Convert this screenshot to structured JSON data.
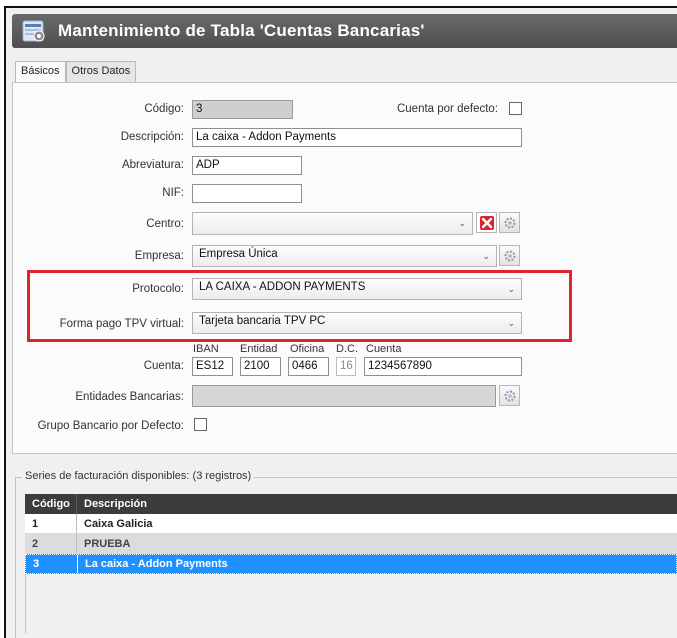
{
  "window": {
    "title": "Mantenimiento de Tabla 'Cuentas Bancarias'"
  },
  "tabs": [
    {
      "label": "Básicos",
      "active": true
    },
    {
      "label": "Otros Datos",
      "active": false
    }
  ],
  "form": {
    "codigo": {
      "label": "Código:",
      "value": "3"
    },
    "cuenta_defecto": {
      "label": "Cuenta por defecto:",
      "checked": false
    },
    "descripcion": {
      "label": "Descripción:",
      "value": "La caixa - Addon Payments"
    },
    "abreviatura": {
      "label": "Abreviatura:",
      "value": "ADP"
    },
    "nif": {
      "label": "NIF:",
      "value": ""
    },
    "centro": {
      "label": "Centro:",
      "value": ""
    },
    "empresa": {
      "label": "Empresa:",
      "value": "Empresa Única"
    },
    "protocolo": {
      "label": "Protocolo:",
      "value": "LA CAIXA - ADDON PAYMENTS"
    },
    "forma_pago": {
      "label": "Forma pago TPV virtual:",
      "value": "Tarjeta bancaria TPV PC"
    },
    "cuenta": {
      "label": "Cuenta:",
      "iban_label": "IBAN",
      "iban": "ES12",
      "entidad_label": "Entidad",
      "entidad": "2100",
      "oficina_label": "Oficina",
      "oficina": "0466",
      "dc_label": "D.C.",
      "dc": "16",
      "cuenta_label": "Cuenta",
      "cuenta": "1234567890"
    },
    "entidades": {
      "label": "Entidades Bancarias:",
      "value": ""
    },
    "grupo_bancario": {
      "label": "Grupo Bancario por Defecto:",
      "checked": false
    }
  },
  "series": {
    "legend": "Series de facturación disponibles: (3 registros)",
    "columns": [
      "Código",
      "Descripción"
    ],
    "rows": [
      {
        "codigo": "1",
        "descripcion": "Caixa Galicia"
      },
      {
        "codigo": "2",
        "descripcion": "PRUEBA"
      },
      {
        "codigo": "3",
        "descripcion": "La caixa - Addon Payments"
      }
    ],
    "selected_index": 2
  },
  "colors": {
    "highlight": "#e0242b",
    "selection": "#1e90ff",
    "titlebar": "#555555"
  },
  "icons": [
    "app-table-icon",
    "delete-x-icon",
    "lookup-gear-icon",
    "chevron-down-icon"
  ]
}
